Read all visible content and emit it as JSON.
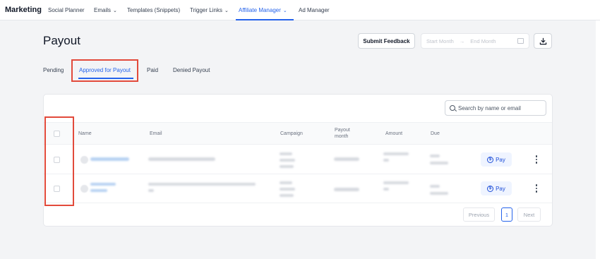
{
  "nav": {
    "brand": "Marketing",
    "items": [
      {
        "label": "Social Planner",
        "chevron": false,
        "active": false
      },
      {
        "label": "Emails",
        "chevron": true,
        "active": false
      },
      {
        "label": "Templates (Snippets)",
        "chevron": false,
        "active": false
      },
      {
        "label": "Trigger Links",
        "chevron": true,
        "active": false
      },
      {
        "label": "Affiliate Manager",
        "chevron": true,
        "active": true
      },
      {
        "label": "Ad Manager",
        "chevron": false,
        "active": false
      }
    ]
  },
  "page": {
    "title": "Payout",
    "submit_feedback_label": "Submit Feedback",
    "date_range": {
      "start_placeholder": "Start Month",
      "end_placeholder": "End Month"
    },
    "tabs": [
      {
        "label": "Pending",
        "active": false
      },
      {
        "label": "Approved for Payout",
        "active": true
      },
      {
        "label": "Paid",
        "active": false
      },
      {
        "label": "Denied Payout",
        "active": false
      }
    ]
  },
  "table": {
    "search_placeholder": "Search by name or email",
    "columns": [
      "Name",
      "Email",
      "Campaign",
      "Payout month",
      "Amount",
      "Due"
    ],
    "rows": [
      {
        "pay_label": "Pay"
      },
      {
        "pay_label": "Pay"
      }
    ],
    "pagination": {
      "previous": "Previous",
      "current_page": "1",
      "next": "Next"
    }
  },
  "colors": {
    "accent": "#2563eb",
    "highlight": "#e24a3b",
    "page_background": "#f3f4f6"
  },
  "icons": [
    "chevron-down-icon",
    "arrow-right-icon",
    "calendar-icon",
    "download-icon",
    "search-icon",
    "dollar-circle-icon",
    "more-vertical-icon"
  ]
}
